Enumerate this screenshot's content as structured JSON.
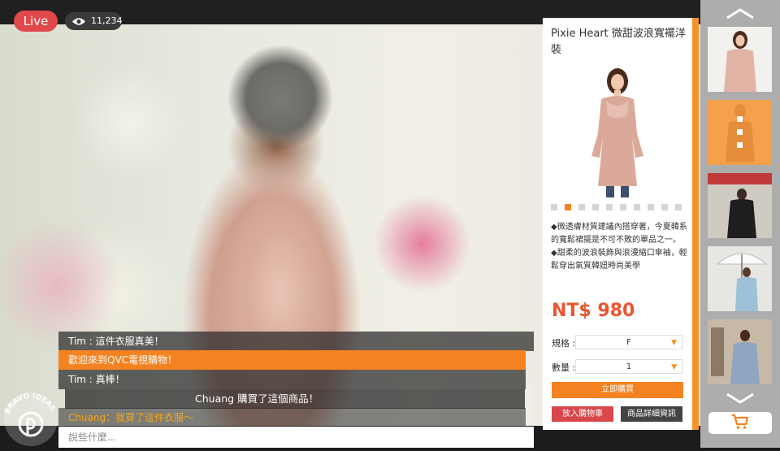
{
  "stream": {
    "live_label": "Live",
    "viewer_count": "11,234",
    "brand_text": "BRAVO IDEAS"
  },
  "chat": {
    "messages": [
      {
        "text": "Tim : 這件衣服真美！",
        "style": "plain"
      },
      {
        "text": "歡迎來到QVC電視購物！",
        "style": "highlight"
      },
      {
        "text": "Tim : 真棒！",
        "style": "plain"
      },
      {
        "text": "Chuang  購買了這個商品！",
        "style": "notice"
      },
      {
        "text": "Chuang：我買了這件衣服～",
        "style": "gold"
      }
    ],
    "input_placeholder": "說些什麼..."
  },
  "product": {
    "title": "Pixie Heart  微甜波浪寬襬洋裝",
    "desc_lines": [
      "◆微透膚材質建議內搭穿著，今夏韓系的寬鬆裙擺是不可不敗的單品之一。",
      "◆甜柔的波浪裝飾與浪漫縮口傘袖，輕鬆穿出氣質韓妞時尚美學"
    ],
    "price": "NT$ 980",
    "gallery": {
      "count": 10,
      "active": 1
    },
    "options": [
      {
        "label": "規格 :",
        "value": "F"
      },
      {
        "label": "數量 :",
        "value": "1"
      }
    ],
    "buy_now": "立即購買",
    "add_to_cart": "放入購物車",
    "details": "商品詳細資訊"
  },
  "colors": {
    "accent": "#f58220",
    "live_red": "#e0484b",
    "price_red": "#e8552e",
    "gold_text": "#f4a51c",
    "rail_gray": "#adadad"
  }
}
